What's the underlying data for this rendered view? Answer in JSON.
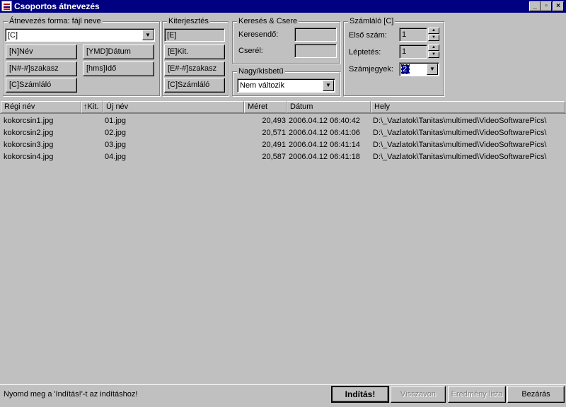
{
  "window": {
    "title": "Csoportos átnevezés"
  },
  "rename": {
    "group_label": "Átnevezés forma: fájl neve",
    "pattern_value": "[C]",
    "buttons": [
      "[N]Név",
      "[YMD]Dátum",
      "[N#-#]szakasz",
      "[hms]Idő",
      "[C]Számláló"
    ]
  },
  "ext": {
    "group_label": "Kiterjesztés",
    "value": "[E]",
    "buttons": [
      "[E]Kit.",
      "[E#-#]szakasz",
      "[C]Számláló"
    ]
  },
  "search": {
    "group_label": "Keresés & Csere",
    "find_label": "Keresendő:",
    "find_value": "",
    "replace_label": "Cserél:",
    "replace_value": ""
  },
  "case": {
    "group_label": "Nagy/kisbetű",
    "value": "Nem változik"
  },
  "counter": {
    "group_label": "Számláló [C]",
    "start_label": "Első szám:",
    "start_value": "1",
    "step_label": "Léptetés:",
    "step_value": "1",
    "digits_label": "Számjegyek:",
    "digits_value": "2"
  },
  "table": {
    "columns": {
      "old_name": "Régi név",
      "ext": "Kit.",
      "new_name": "Új név",
      "size": "Méret",
      "date": "Dátum",
      "path": "Hely"
    },
    "rows": [
      {
        "old": "kokorcsin1.jpg",
        "new": "01.jpg",
        "size": "20,493",
        "date": "2006.04.12 06:40:42",
        "path": "D:\\_Vazlatok\\Tanitas\\multimed\\VideoSoftwarePics\\"
      },
      {
        "old": "kokorcsin2.jpg",
        "new": "02.jpg",
        "size": "20,571",
        "date": "2006.04.12 06:41:06",
        "path": "D:\\_Vazlatok\\Tanitas\\multimed\\VideoSoftwarePics\\"
      },
      {
        "old": "kokorcsin3.jpg",
        "new": "03.jpg",
        "size": "20,491",
        "date": "2006.04.12 06:41:14",
        "path": "D:\\_Vazlatok\\Tanitas\\multimed\\VideoSoftwarePics\\"
      },
      {
        "old": "kokorcsin4.jpg",
        "new": "04.jpg",
        "size": "20,587",
        "date": "2006.04.12 06:41:18",
        "path": "D:\\_Vazlatok\\Tanitas\\multimed\\VideoSoftwarePics\\"
      }
    ]
  },
  "statusbar": {
    "text": "Nyomd meg a 'Indítás!'-t az indításhoz!"
  },
  "actions": {
    "start": "Indítás!",
    "undo": "Visszavon",
    "results": "Eredmény lista",
    "close": "Bezárás"
  }
}
